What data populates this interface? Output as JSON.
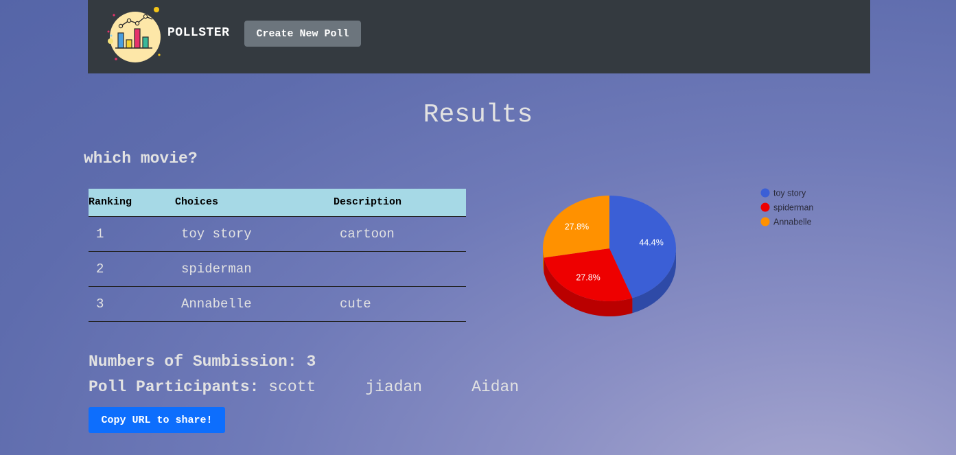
{
  "navbar": {
    "brand": "POLLSTER",
    "create_button": "Create New Poll",
    "logo_icon": "bar-chart-logo-icon"
  },
  "page": {
    "title": "Results",
    "question": "which movie?"
  },
  "table": {
    "headers": [
      "Ranking",
      "Choices",
      "Description"
    ],
    "rows": [
      {
        "ranking": "1",
        "choice": "toy story",
        "description": "cartoon"
      },
      {
        "ranking": "2",
        "choice": "spiderman",
        "description": ""
      },
      {
        "ranking": "3",
        "choice": "Annabelle",
        "description": "cute"
      }
    ]
  },
  "chart_data": {
    "type": "pie",
    "categories": [
      "toy story",
      "spiderman",
      "Annabelle"
    ],
    "values": [
      44.4,
      27.8,
      27.8
    ],
    "labels": [
      "44.4%",
      "27.8%",
      "27.8%"
    ],
    "colors": [
      "#3b5fd6",
      "#ee0000",
      "#ff9100"
    ],
    "legend": "right"
  },
  "stats": {
    "submissions_label": "Numbers of Sumbission:",
    "submissions_count": "3",
    "participants_label": "Poll Participants:",
    "participants": [
      "scott",
      "jiadan",
      "Aidan"
    ]
  },
  "copy_button": "Copy URL to share!"
}
